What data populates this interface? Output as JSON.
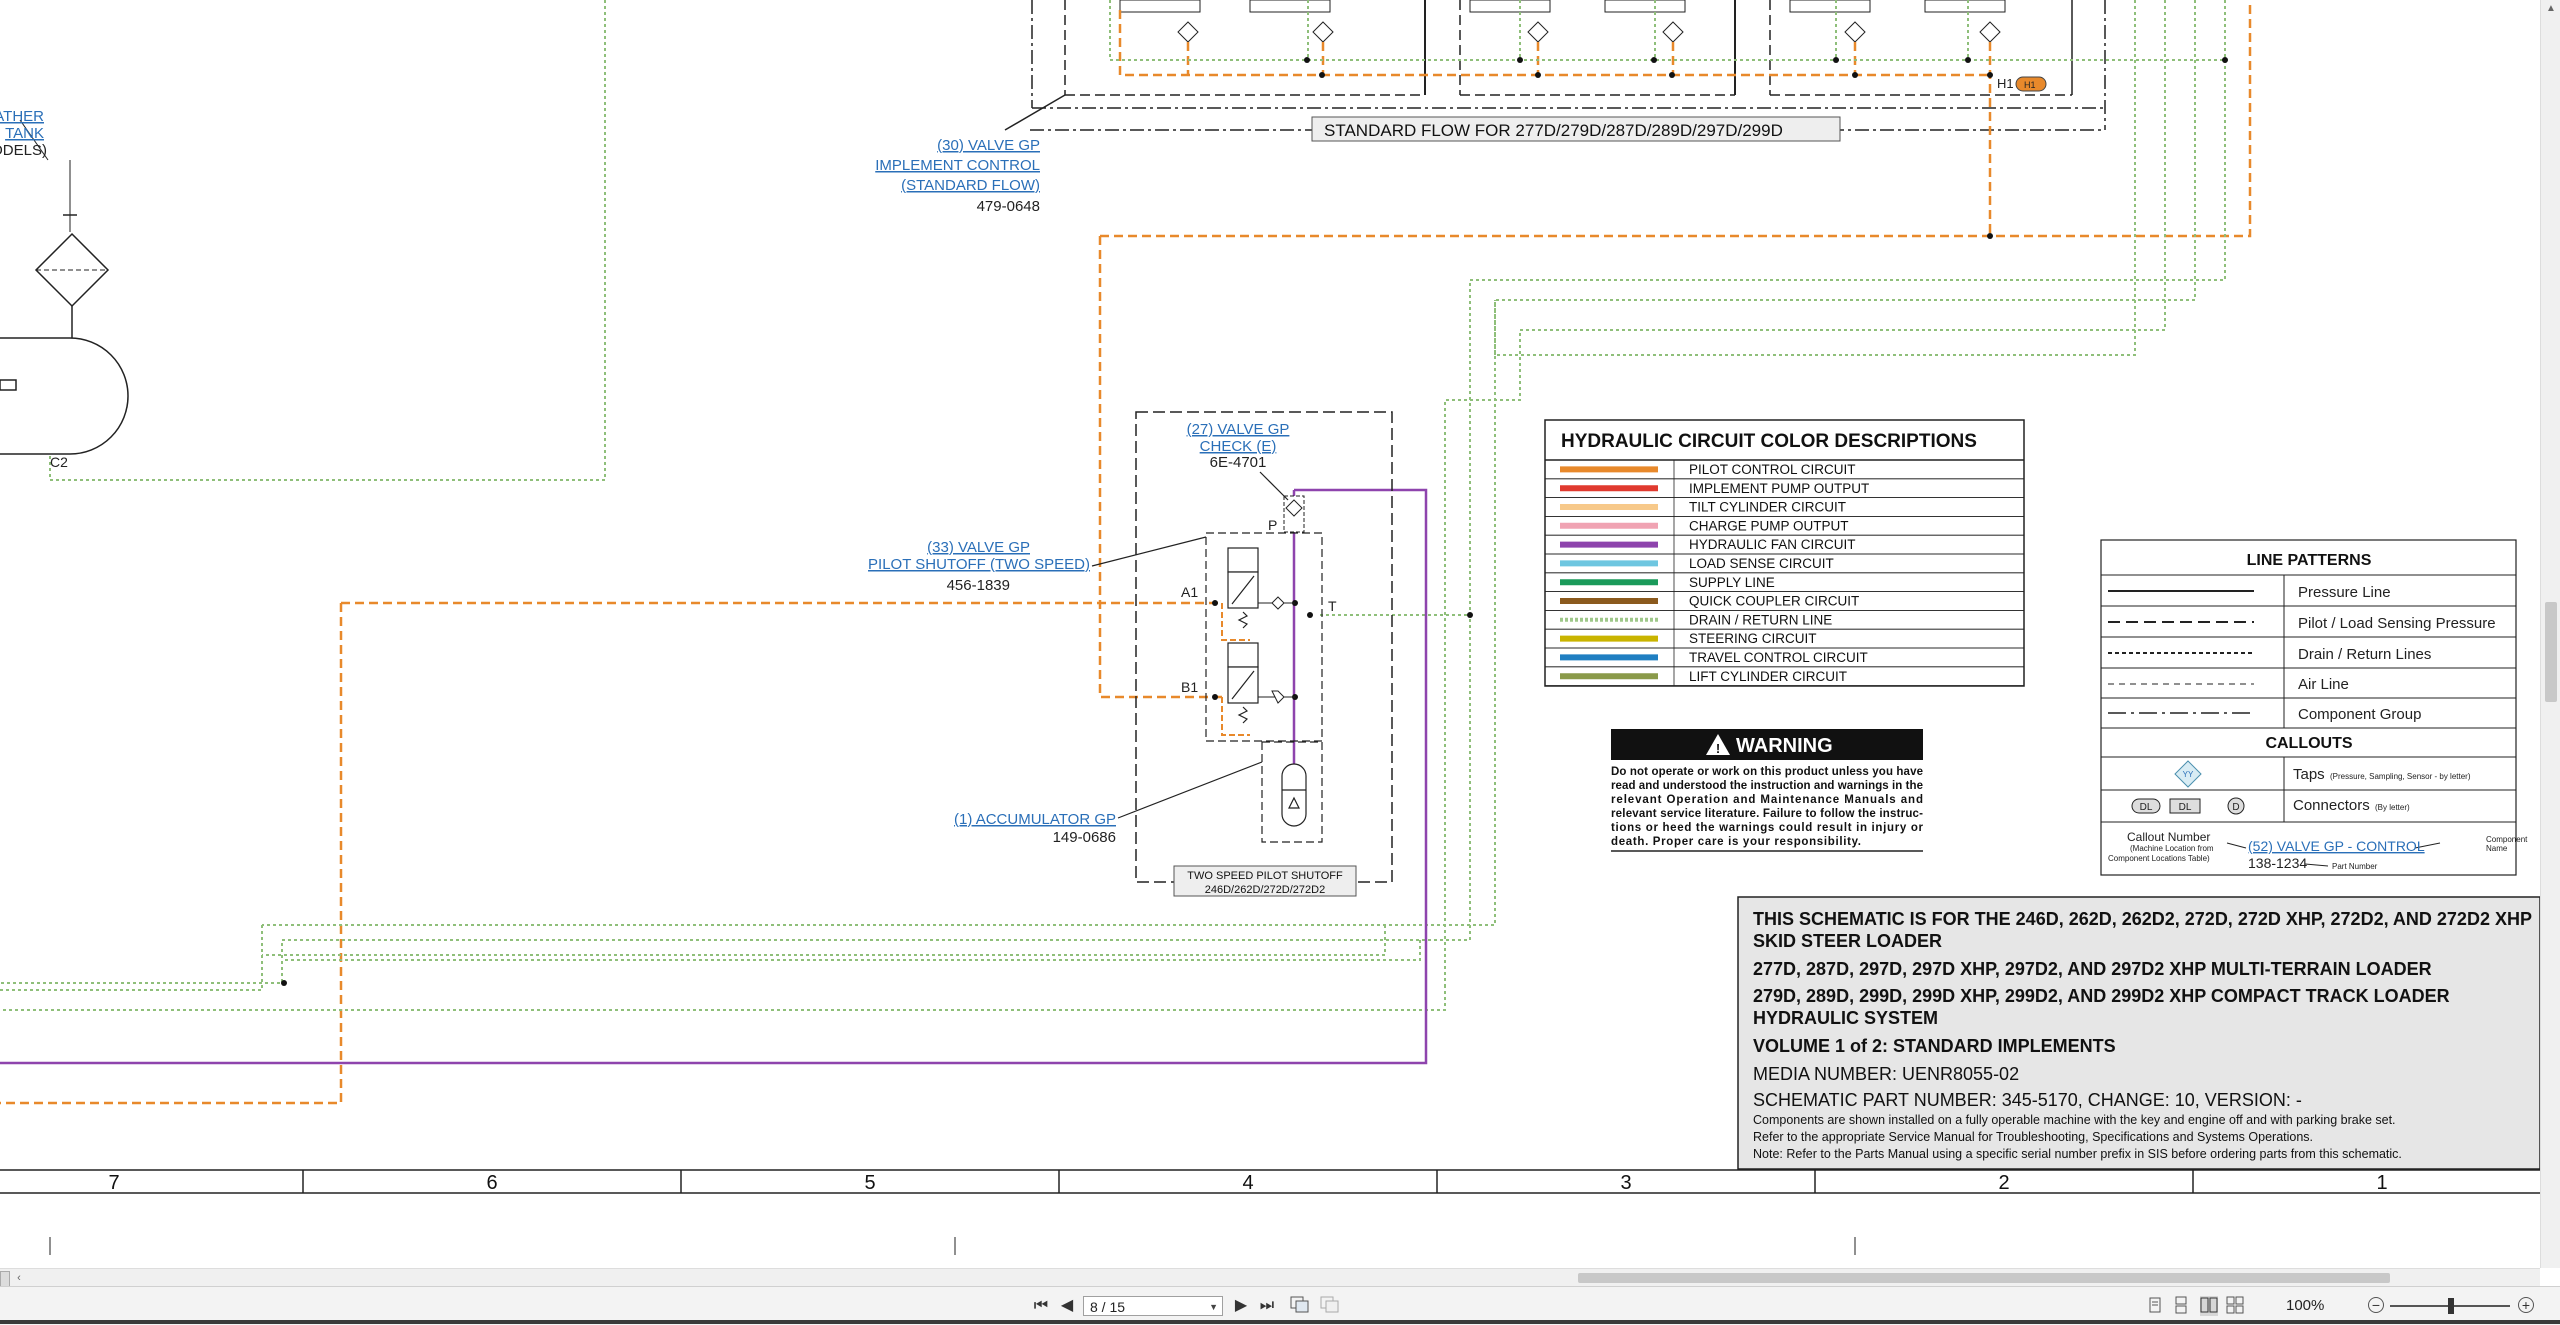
{
  "schematic": {
    "standard_flow_label": "STANDARD FLOW FOR 277D/279D/287D/289D/297D/299D",
    "h1_label": "H1",
    "h1_badge": "H1",
    "callouts": {
      "valve30": {
        "line1": "(30) VALVE GP",
        "line2": "IMPLEMENT CONTROL",
        "line3": "(STANDARD FLOW)",
        "part": "479-0648"
      },
      "valve27": {
        "line1": "(27) VALVE GP",
        "line2": "CHECK (E)",
        "part": "6E-4701"
      },
      "valve33": {
        "line1": "(33) VALVE GP",
        "line2": "PILOT SHUTOFF (TWO SPEED)",
        "part": "456-1839"
      },
      "accumulator": {
        "line1": "(1) ACCUMULATOR GP",
        "part": "149-0686"
      },
      "partial_left": {
        "line1": "ATHER",
        "line2": "TANK",
        "line3": "ODELS)"
      }
    },
    "ports": {
      "p": "P",
      "t": "T",
      "a1": "A1",
      "b1": "B1",
      "c2": "C2"
    },
    "two_speed_box": {
      "line1": "TWO SPEED PILOT SHUTOFF",
      "line2": "246D/262D/272D/272D2"
    }
  },
  "color_table": {
    "title": "HYDRAULIC CIRCUIT COLOR DESCRIPTIONS",
    "rows": [
      {
        "label": "PILOT CONTROL CIRCUIT",
        "color": "#e8892b",
        "style": "solid"
      },
      {
        "label": "IMPLEMENT PUMP OUTPUT",
        "color": "#e03a2f",
        "style": "solid"
      },
      {
        "label": "TILT CYLINDER CIRCUIT",
        "color": "#f7c98a",
        "style": "solid"
      },
      {
        "label": "CHARGE PUMP OUTPUT",
        "color": "#f0a3b3",
        "style": "solid"
      },
      {
        "label": "HYDRAULIC FAN CIRCUIT",
        "color": "#8e44ad",
        "style": "solid"
      },
      {
        "label": "LOAD SENSE CIRCUIT",
        "color": "#6ec6e0",
        "style": "solid"
      },
      {
        "label": "SUPPLY LINE",
        "color": "#1a9a5a",
        "style": "solid"
      },
      {
        "label": "QUICK COUPLER CIRCUIT",
        "color": "#8b5a1e",
        "style": "solid"
      },
      {
        "label": "DRAIN / RETURN LINE",
        "color": "#9fc88a",
        "style": "dotted"
      },
      {
        "label": "STEERING CIRCUIT",
        "color": "#c9b400",
        "style": "solid"
      },
      {
        "label": "TRAVEL CONTROL CIRCUIT",
        "color": "#1f7fc2",
        "style": "solid"
      },
      {
        "label": "LIFT CYLINDER CIRCUIT",
        "color": "#8a9a4a",
        "style": "solid"
      }
    ]
  },
  "warning": {
    "title": "WARNING",
    "lines": [
      "Do not operate or work on this product unless you have",
      "read and understood the instruction and warnings in the",
      "relevant Operation and Maintenance Manuals and",
      "relevant service literature. Failure to follow the instruc-",
      "tions or heed the warnings could result in injury or",
      "death. Proper care is your responsibility."
    ]
  },
  "line_patterns": {
    "title": "LINE PATTERNS",
    "rows": [
      "Pressure Line",
      "Pilot / Load Sensing Pressure",
      "Drain / Return Lines",
      "Air Line",
      "Component Group"
    ],
    "callouts_title": "CALLOUTS",
    "taps_label": "Taps",
    "taps_note": "(Pressure, Sampling, Sensor - by letter)",
    "taps_symbol": "YY",
    "connectors_label": "Connectors",
    "connectors_note": "(By letter)",
    "connector_symbols": [
      "DL",
      "DL",
      "D"
    ],
    "callout_number": "Callout Number",
    "machine_location_1": "(Machine Location from",
    "machine_location_2": "Component Locations Table)",
    "example_name": "(52) VALVE GP - CONTROL",
    "example_part": "138-1234",
    "component_name_1": "Component",
    "component_name_2": "Name",
    "part_number": "Part Number"
  },
  "title_block": {
    "line1": "THIS SCHEMATIC IS FOR THE 246D, 262D, 262D2, 272D, 272D XHP, 272D2, AND 272D2 XHP",
    "line2": "SKID STEER LOADER",
    "line3": "277D, 287D, 297D, 297D XHP, 297D2, AND 297D2 XHP MULTI-TERRAIN LOADER",
    "line4": "279D, 289D, 299D, 299D XHP, 299D2, AND 299D2 XHP COMPACT TRACK LOADER",
    "line5": "HYDRAULIC SYSTEM",
    "line6": "VOLUME 1 of 2: STANDARD IMPLEMENTS",
    "media": "MEDIA NUMBER: UENR8055-02",
    "part": "SCHEMATIC PART NUMBER: 345-5170, CHANGE: 10, VERSION: -",
    "note1": "Components are shown installed on a fully operable machine with the key and engine off and with parking brake set.",
    "note2": "Refer to the appropriate Service Manual for Troubleshooting, Specifications and Systems Operations.",
    "note3": "Note: Refer to the Parts Manual using a specific serial number prefix in SIS before ordering parts from this schematic."
  },
  "zones": [
    "7",
    "6",
    "5",
    "4",
    "3",
    "2",
    "1"
  ],
  "toolbar": {
    "page_value": "8 / 15",
    "zoom": "100%",
    "first_page": "⏮",
    "prev_page": "◀",
    "next_page": "▶",
    "last_page": "⏭",
    "zoom_out": "−",
    "zoom_in": "+"
  }
}
